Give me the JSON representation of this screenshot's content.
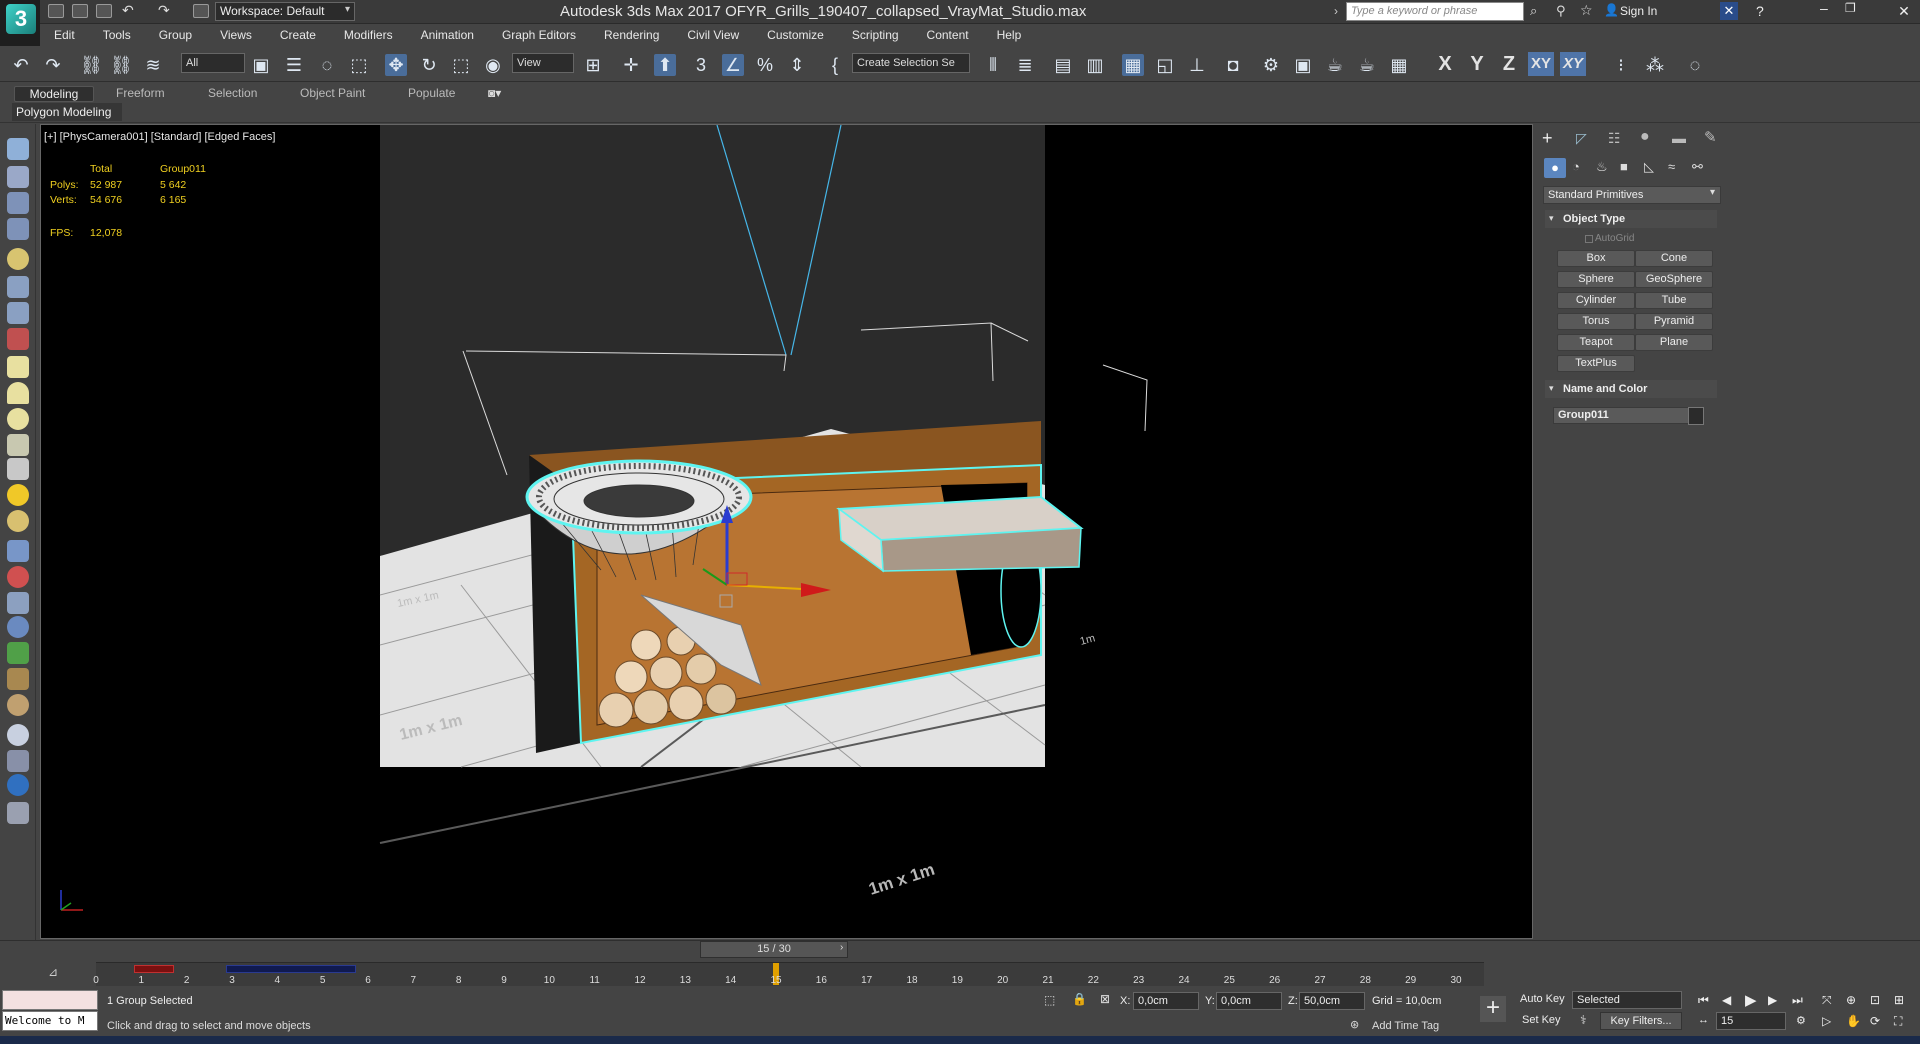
{
  "app": {
    "title": "Autodesk 3ds Max 2017    OFYR_Grills_190407_collapsed_VrayMat_Studio.max",
    "workspace": "Workspace: Default",
    "search_placeholder": "Type a keyword or phrase",
    "sign_in": "Sign In"
  },
  "menu": [
    "Edit",
    "Tools",
    "Group",
    "Views",
    "Create",
    "Modifiers",
    "Animation",
    "Graph Editors",
    "Rendering",
    "Civil View",
    "Customize",
    "Scripting",
    "Content",
    "Help"
  ],
  "toolbar": {
    "selection_filter": "All",
    "ref_coord": "View",
    "named_selection": "Create Selection Se",
    "axes": [
      "X",
      "Y",
      "Z",
      "XY",
      "XY"
    ]
  },
  "ribbon": {
    "tabs": [
      "Modeling",
      "Freeform",
      "Selection",
      "Object Paint",
      "Populate"
    ],
    "sub": "Polygon Modeling"
  },
  "viewport": {
    "label": "[+] [PhysCamera001] [Standard] [Edged Faces]",
    "stats": {
      "header_total": "Total",
      "header_group": "Group011",
      "polys_label": "Polys:",
      "polys_total": "52 987",
      "polys_group": "5 642",
      "verts_label": "Verts:",
      "verts_total": "54 676",
      "verts_group": "6 165",
      "fps_label": "FPS:",
      "fps_value": "12,078"
    },
    "grid_labels": [
      "1m x 1m",
      "1m x 1m",
      "1m x 1m",
      "1m"
    ]
  },
  "command_panel": {
    "dropdown": "Standard Primitives",
    "object_type_title": "Object Type",
    "autogrid": "AutoGrid",
    "buttons": [
      "Box",
      "Cone",
      "Sphere",
      "GeoSphere",
      "Cylinder",
      "Tube",
      "Torus",
      "Pyramid",
      "Teapot",
      "Plane",
      "TextPlus"
    ],
    "name_color_title": "Name and Color",
    "object_name": "Group011"
  },
  "timeline": {
    "slider": "15 / 30",
    "current_frame": 15,
    "ticks": [
      "0",
      "1",
      "2",
      "3",
      "4",
      "5",
      "6",
      "7",
      "8",
      "9",
      "10",
      "11",
      "12",
      "13",
      "14",
      "15",
      "16",
      "17",
      "18",
      "19",
      "20",
      "21",
      "22",
      "23",
      "24",
      "25",
      "26",
      "27",
      "28",
      "29",
      "30"
    ]
  },
  "status": {
    "selected": "1 Group Selected",
    "prompt": "Click and drag to select and move objects",
    "maxscript": "Welcome to M",
    "x_label": "X:",
    "x_value": "0,0cm",
    "y_label": "Y:",
    "y_value": "0,0cm",
    "z_label": "Z:",
    "z_value": "50,0cm",
    "grid": "Grid = 10,0cm",
    "add_time_tag": "Add Time Tag",
    "auto_key": "Auto Key",
    "set_key": "Set Key",
    "key_mode": "Selected",
    "key_filters": "Key Filters...",
    "frame_field": "15"
  },
  "colors": {
    "selection_cyan": "#5ef4f0",
    "viewport_bg": "#2b2b2b",
    "floor": "#e2e2e2",
    "cabinet": "#a2611f",
    "stats_yellow": "#f0d020"
  }
}
